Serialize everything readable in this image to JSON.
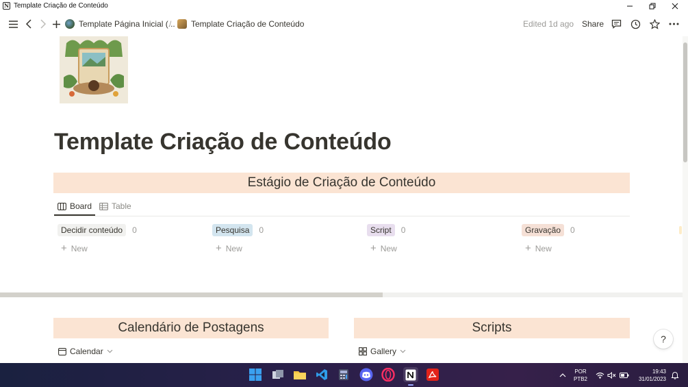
{
  "window": {
    "title": "Template Criação de Conteúdo",
    "app_icon_letter": "N"
  },
  "topbar": {
    "breadcrumbs": [
      {
        "label": "Template Página Inicial (..."
      },
      {
        "label": "Template Criação de Conteúdo"
      }
    ],
    "separator": "/",
    "edited": "Edited 1d ago",
    "share": "Share"
  },
  "page": {
    "title": "Template Criação de Conteúdo"
  },
  "board_section": {
    "heading": "Estágio de Criação de Conteúdo",
    "tabs": [
      {
        "label": "Board",
        "active": true
      },
      {
        "label": "Table",
        "active": false
      }
    ],
    "columns": [
      {
        "label": "Decidir conteúdo",
        "count": "0",
        "color": "#f1f1ef",
        "new_label": "New"
      },
      {
        "label": "Pesquisa",
        "count": "0",
        "color": "#d3e5ef",
        "new_label": "New"
      },
      {
        "label": "Script",
        "count": "0",
        "color": "#e8deee",
        "new_label": "New"
      },
      {
        "label": "Gravação",
        "count": "0",
        "color": "#f5e0d6",
        "new_label": "New"
      }
    ]
  },
  "calendar_section": {
    "heading": "Calendário de Postagens",
    "view_label": "Calendar"
  },
  "scripts_section": {
    "heading": "Scripts",
    "view_label": "Gallery"
  },
  "help_button": "?",
  "taskbar": {
    "language": "POR",
    "layout": "PTB2",
    "time": "19:43",
    "date": "31/01/2023"
  }
}
